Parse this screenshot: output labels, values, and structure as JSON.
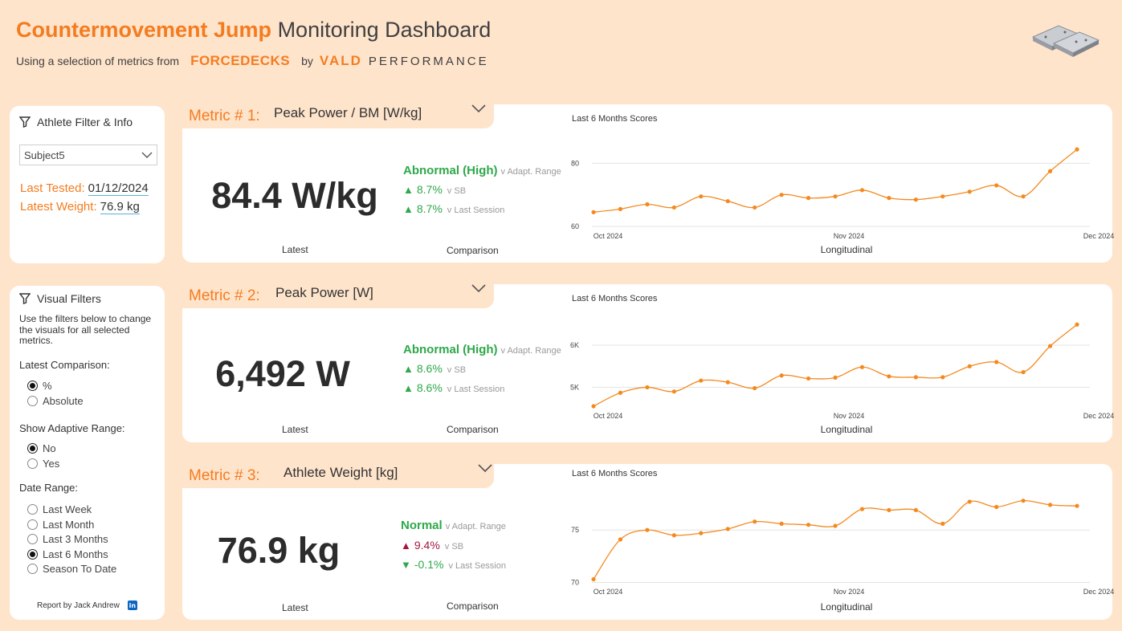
{
  "header": {
    "title_accent": "Countermovement Jump",
    "title_rest": "Monitoring Dashboard",
    "subtitle": "Using a selection of metrics from",
    "brand_forcedecks": "FORCEDECKS",
    "brand_by": "by",
    "brand_vald": "VALD",
    "brand_performance": "PERFORMANCE",
    "logo_icon": "force-plates-icon"
  },
  "athlete": {
    "title": "Athlete Filter & Info",
    "selected": "Subject5",
    "last_tested_label": "Last Tested:",
    "last_tested": "01/12/2024",
    "latest_weight_label": "Latest Weight:",
    "latest_weight": "76.9 kg"
  },
  "visual_filters": {
    "title": "Visual Filters",
    "description": "Use the filters below to change the visuals for all selected metrics.",
    "latest_comparison_label": "Latest Comparison:",
    "latest_comparison_options": [
      {
        "label": "%",
        "selected": true
      },
      {
        "label": "Absolute",
        "selected": false
      }
    ],
    "adaptive_range_label": "Show Adaptive Range:",
    "adaptive_range_options": [
      {
        "label": "No",
        "selected": true
      },
      {
        "label": "Yes",
        "selected": false
      }
    ],
    "date_range_label": "Date Range:",
    "date_range_options": [
      {
        "label": "Last Week",
        "selected": false
      },
      {
        "label": "Last Month",
        "selected": false
      },
      {
        "label": "Last 3 Months",
        "selected": false
      },
      {
        "label": "Last 6 Months",
        "selected": true
      },
      {
        "label": "Season To Date",
        "selected": false
      }
    ],
    "credit": "Report by Jack Andrew",
    "credit_icon": "linkedin-icon"
  },
  "colors": {
    "accent": "#f47c20",
    "background": "#ffe4cc",
    "positive": "#2ea84a",
    "negative": "#a3173f",
    "line": "#f4891f"
  },
  "metrics": [
    {
      "label": "Metric # 1:",
      "name": "Peak Power / BM [W/kg]",
      "value": "84.4 W/kg",
      "latest_caption": "Latest",
      "comparison_caption": "Comparison",
      "longitudinal_caption": "Longitudinal",
      "status": "Abnormal (High)",
      "status_sub": "v Adapt. Range",
      "cmp_sb": {
        "direction": "up",
        "value": "8.7%",
        "label": "v SB"
      },
      "cmp_last": {
        "direction": "up",
        "value": "8.7%",
        "label": "v Last Session"
      },
      "chart_title": "Last 6 Months Scores"
    },
    {
      "label": "Metric # 2:",
      "name": "Peak Power [W]",
      "value": "6,492 W",
      "latest_caption": "Latest",
      "comparison_caption": "Comparison",
      "longitudinal_caption": "Longitudinal",
      "status": "Abnormal (High)",
      "status_sub": "v Adapt. Range",
      "cmp_sb": {
        "direction": "up",
        "value": "8.6%",
        "label": "v SB"
      },
      "cmp_last": {
        "direction": "up",
        "value": "8.6%",
        "label": "v Last Session"
      },
      "chart_title": "Last 6 Months Scores"
    },
    {
      "label": "Metric # 3:",
      "name": "Athlete Weight [kg]",
      "value": "76.9 kg",
      "latest_caption": "Latest",
      "comparison_caption": "Comparison",
      "longitudinal_caption": "Longitudinal",
      "status": "Normal",
      "status_sub": "v Adapt. Range",
      "cmp_sb": {
        "direction": "up",
        "value": "9.4%",
        "label": "v SB"
      },
      "cmp_last": {
        "direction": "down",
        "value": "-0.1%",
        "label": "v Last Session"
      },
      "chart_title": "Last 6 Months Scores"
    }
  ],
  "chart_data": [
    {
      "type": "line",
      "title": "Last 6 Months Scores",
      "xlabel": "Longitudinal",
      "x_tick_labels": [
        "Oct 2024",
        "Nov 2024",
        "Dec 2024"
      ],
      "y_tick_labels": [
        "60",
        "80"
      ],
      "yticks": [
        60,
        80
      ],
      "ylim": [
        60,
        88
      ],
      "grid": true,
      "series": [
        {
          "values": [
            64.5,
            65.5,
            67,
            66,
            69.5,
            68,
            66,
            70,
            69,
            69.5,
            71.5,
            69,
            68.5,
            69.5,
            71,
            73,
            69.5,
            77.5,
            84.4
          ]
        }
      ]
    },
    {
      "type": "line",
      "title": "Last 6 Months Scores",
      "xlabel": "Longitudinal",
      "x_tick_labels": [
        "Oct 2024",
        "Nov 2024",
        "Dec 2024"
      ],
      "y_tick_labels": [
        "5K",
        "6K"
      ],
      "yticks": [
        5000,
        6000
      ],
      "ylim": [
        4550,
        6650
      ],
      "grid": true,
      "series": [
        {
          "values": [
            4550,
            4870,
            5000,
            4900,
            5160,
            5120,
            4980,
            5280,
            5210,
            5230,
            5480,
            5260,
            5240,
            5240,
            5500,
            5600,
            5360,
            5980,
            6492
          ]
        }
      ]
    },
    {
      "type": "line",
      "title": "Last 6 Months Scores",
      "xlabel": "Longitudinal",
      "x_tick_labels": [
        "Oct 2024",
        "Nov 2024",
        "Dec 2024"
      ],
      "y_tick_labels": [
        "70",
        "75"
      ],
      "yticks": [
        70,
        75
      ],
      "ylim": [
        69.5,
        79
      ],
      "grid": true,
      "series": [
        {
          "values": [
            70.3,
            74.1,
            75,
            74.5,
            74.7,
            75.1,
            75.8,
            75.6,
            75.5,
            75.4,
            77.0,
            76.9,
            76.9,
            75.6,
            77.7,
            77.2,
            77.8,
            77.4,
            77.3
          ]
        }
      ]
    }
  ]
}
